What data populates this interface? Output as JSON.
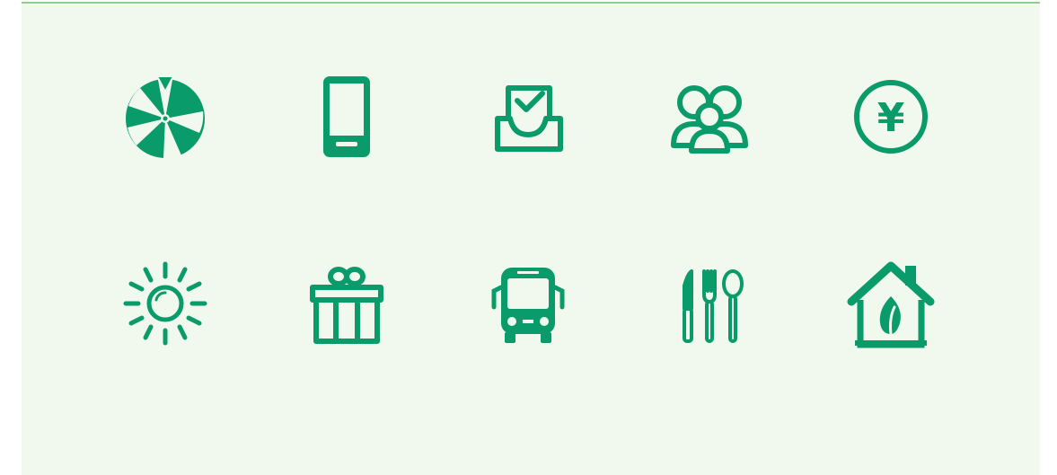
{
  "theme": {
    "icon_color": "#0a9b6a",
    "panel_background": "#f1f8ee",
    "top_border": "#8fd08a"
  },
  "icons": [
    "prize-wheel-icon",
    "mobile-phone-icon",
    "inbox-check-icon",
    "group-people-icon",
    "yen-coin-icon",
    "sun-icon",
    "gift-box-icon",
    "bus-icon",
    "cutlery-icon",
    "eco-house-icon"
  ],
  "yen": {
    "symbol": "¥"
  }
}
